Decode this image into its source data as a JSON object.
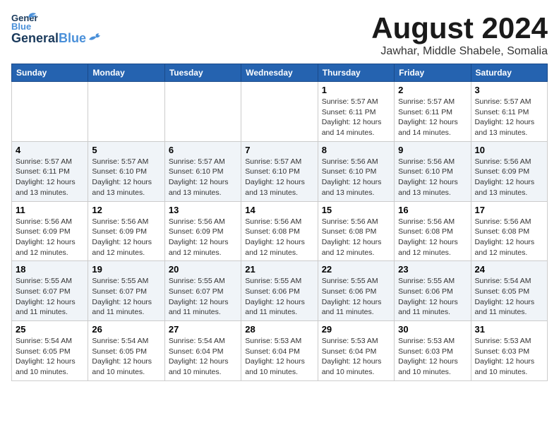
{
  "header": {
    "logo_general": "General",
    "logo_blue": "Blue",
    "month_title": "August 2024",
    "subtitle": "Jawhar, Middle Shabele, Somalia"
  },
  "days_of_week": [
    "Sunday",
    "Monday",
    "Tuesday",
    "Wednesday",
    "Thursday",
    "Friday",
    "Saturday"
  ],
  "weeks": [
    [
      {
        "day": "",
        "info": ""
      },
      {
        "day": "",
        "info": ""
      },
      {
        "day": "",
        "info": ""
      },
      {
        "day": "",
        "info": ""
      },
      {
        "day": "1",
        "info": "Sunrise: 5:57 AM\nSunset: 6:11 PM\nDaylight: 12 hours\nand 14 minutes."
      },
      {
        "day": "2",
        "info": "Sunrise: 5:57 AM\nSunset: 6:11 PM\nDaylight: 12 hours\nand 14 minutes."
      },
      {
        "day": "3",
        "info": "Sunrise: 5:57 AM\nSunset: 6:11 PM\nDaylight: 12 hours\nand 13 minutes."
      }
    ],
    [
      {
        "day": "4",
        "info": "Sunrise: 5:57 AM\nSunset: 6:11 PM\nDaylight: 12 hours\nand 13 minutes."
      },
      {
        "day": "5",
        "info": "Sunrise: 5:57 AM\nSunset: 6:10 PM\nDaylight: 12 hours\nand 13 minutes."
      },
      {
        "day": "6",
        "info": "Sunrise: 5:57 AM\nSunset: 6:10 PM\nDaylight: 12 hours\nand 13 minutes."
      },
      {
        "day": "7",
        "info": "Sunrise: 5:57 AM\nSunset: 6:10 PM\nDaylight: 12 hours\nand 13 minutes."
      },
      {
        "day": "8",
        "info": "Sunrise: 5:56 AM\nSunset: 6:10 PM\nDaylight: 12 hours\nand 13 minutes."
      },
      {
        "day": "9",
        "info": "Sunrise: 5:56 AM\nSunset: 6:10 PM\nDaylight: 12 hours\nand 13 minutes."
      },
      {
        "day": "10",
        "info": "Sunrise: 5:56 AM\nSunset: 6:09 PM\nDaylight: 12 hours\nand 13 minutes."
      }
    ],
    [
      {
        "day": "11",
        "info": "Sunrise: 5:56 AM\nSunset: 6:09 PM\nDaylight: 12 hours\nand 12 minutes."
      },
      {
        "day": "12",
        "info": "Sunrise: 5:56 AM\nSunset: 6:09 PM\nDaylight: 12 hours\nand 12 minutes."
      },
      {
        "day": "13",
        "info": "Sunrise: 5:56 AM\nSunset: 6:09 PM\nDaylight: 12 hours\nand 12 minutes."
      },
      {
        "day": "14",
        "info": "Sunrise: 5:56 AM\nSunset: 6:08 PM\nDaylight: 12 hours\nand 12 minutes."
      },
      {
        "day": "15",
        "info": "Sunrise: 5:56 AM\nSunset: 6:08 PM\nDaylight: 12 hours\nand 12 minutes."
      },
      {
        "day": "16",
        "info": "Sunrise: 5:56 AM\nSunset: 6:08 PM\nDaylight: 12 hours\nand 12 minutes."
      },
      {
        "day": "17",
        "info": "Sunrise: 5:56 AM\nSunset: 6:08 PM\nDaylight: 12 hours\nand 12 minutes."
      }
    ],
    [
      {
        "day": "18",
        "info": "Sunrise: 5:55 AM\nSunset: 6:07 PM\nDaylight: 12 hours\nand 11 minutes."
      },
      {
        "day": "19",
        "info": "Sunrise: 5:55 AM\nSunset: 6:07 PM\nDaylight: 12 hours\nand 11 minutes."
      },
      {
        "day": "20",
        "info": "Sunrise: 5:55 AM\nSunset: 6:07 PM\nDaylight: 12 hours\nand 11 minutes."
      },
      {
        "day": "21",
        "info": "Sunrise: 5:55 AM\nSunset: 6:06 PM\nDaylight: 12 hours\nand 11 minutes."
      },
      {
        "day": "22",
        "info": "Sunrise: 5:55 AM\nSunset: 6:06 PM\nDaylight: 12 hours\nand 11 minutes."
      },
      {
        "day": "23",
        "info": "Sunrise: 5:55 AM\nSunset: 6:06 PM\nDaylight: 12 hours\nand 11 minutes."
      },
      {
        "day": "24",
        "info": "Sunrise: 5:54 AM\nSunset: 6:05 PM\nDaylight: 12 hours\nand 11 minutes."
      }
    ],
    [
      {
        "day": "25",
        "info": "Sunrise: 5:54 AM\nSunset: 6:05 PM\nDaylight: 12 hours\nand 10 minutes."
      },
      {
        "day": "26",
        "info": "Sunrise: 5:54 AM\nSunset: 6:05 PM\nDaylight: 12 hours\nand 10 minutes."
      },
      {
        "day": "27",
        "info": "Sunrise: 5:54 AM\nSunset: 6:04 PM\nDaylight: 12 hours\nand 10 minutes."
      },
      {
        "day": "28",
        "info": "Sunrise: 5:53 AM\nSunset: 6:04 PM\nDaylight: 12 hours\nand 10 minutes."
      },
      {
        "day": "29",
        "info": "Sunrise: 5:53 AM\nSunset: 6:04 PM\nDaylight: 12 hours\nand 10 minutes."
      },
      {
        "day": "30",
        "info": "Sunrise: 5:53 AM\nSunset: 6:03 PM\nDaylight: 12 hours\nand 10 minutes."
      },
      {
        "day": "31",
        "info": "Sunrise: 5:53 AM\nSunset: 6:03 PM\nDaylight: 12 hours\nand 10 minutes."
      }
    ]
  ]
}
